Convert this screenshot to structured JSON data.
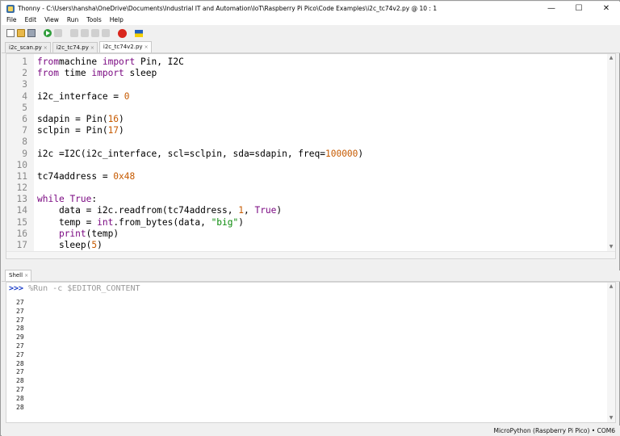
{
  "window": {
    "title": "Thonny  -  C:\\Users\\hansha\\OneDrive\\Documents\\Industrial IT and Automation\\IoT\\Raspberry Pi Pico\\Code Examples\\i2c_tc74v2.py  @  10 : 1",
    "minimize": "—",
    "maximize": "☐",
    "close": "✕"
  },
  "menu": [
    "File",
    "Edit",
    "View",
    "Run",
    "Tools",
    "Help"
  ],
  "tabs": [
    {
      "label": "i2c_scan.py",
      "active": false
    },
    {
      "label": "i2c_tc74.py",
      "active": false
    },
    {
      "label": "i2c_tc74v2.py",
      "active": true
    }
  ],
  "tab_close": "×",
  "editor": {
    "lines": [
      {
        "n": "1",
        "t": [
          [
            "kw",
            "from"
          ],
          [
            "",
            "machine "
          ],
          [
            "kw",
            "import"
          ],
          [
            "",
            " Pin, I2C"
          ]
        ]
      },
      {
        "n": "2",
        "t": [
          [
            "kw",
            "from"
          ],
          [
            "",
            " time "
          ],
          [
            "kw",
            "import"
          ],
          [
            "",
            " sleep"
          ]
        ]
      },
      {
        "n": "3",
        "t": []
      },
      {
        "n": "4",
        "t": [
          [
            "",
            "i2c_interface = "
          ],
          [
            "num",
            "0"
          ]
        ]
      },
      {
        "n": "5",
        "t": []
      },
      {
        "n": "6",
        "t": [
          [
            "",
            "sdapin = Pin("
          ],
          [
            "num",
            "16"
          ],
          [
            "",
            ")"
          ]
        ]
      },
      {
        "n": "7",
        "t": [
          [
            "",
            "sclpin = Pin("
          ],
          [
            "num",
            "17"
          ],
          [
            "",
            ")"
          ]
        ]
      },
      {
        "n": "8",
        "t": []
      },
      {
        "n": "9",
        "t": [
          [
            "",
            "i2c =I2C(i2c_interface, scl=sclpin, sda=sdapin, freq="
          ],
          [
            "num",
            "100000"
          ],
          [
            "",
            ")"
          ]
        ]
      },
      {
        "n": "10",
        "t": []
      },
      {
        "n": "11",
        "t": [
          [
            "",
            "tc74address = "
          ],
          [
            "num",
            "0x48"
          ]
        ]
      },
      {
        "n": "12",
        "t": []
      },
      {
        "n": "13",
        "t": [
          [
            "kw",
            "while"
          ],
          [
            "",
            " "
          ],
          [
            "kw",
            "True"
          ],
          [
            "",
            ":"
          ]
        ]
      },
      {
        "n": "14",
        "t": [
          [
            "",
            "    data = i2c.readfrom(tc74address, "
          ],
          [
            "num",
            "1"
          ],
          [
            "",
            ", "
          ],
          [
            "kw",
            "True"
          ],
          [
            "",
            ")"
          ]
        ]
      },
      {
        "n": "15",
        "t": [
          [
            "",
            "    temp = "
          ],
          [
            "bi",
            "int"
          ],
          [
            "",
            ".from_bytes(data, "
          ],
          [
            "str",
            "\"big\""
          ],
          [
            "",
            ")"
          ]
        ]
      },
      {
        "n": "16",
        "t": [
          [
            "",
            "    "
          ],
          [
            "bi",
            "print"
          ],
          [
            "",
            "(temp)"
          ]
        ]
      },
      {
        "n": "17",
        "t": [
          [
            "",
            "    sleep("
          ],
          [
            "num",
            "5"
          ],
          [
            "",
            ")"
          ]
        ]
      }
    ]
  },
  "shell": {
    "tab_label": "Shell",
    "prompt": ">>>",
    "command": " %Run -c $EDITOR_CONTENT",
    "output": [
      "27",
      "27",
      "27",
      "28",
      "29",
      "27",
      "27",
      "28",
      "27",
      "28",
      "27",
      "28",
      "28"
    ]
  },
  "status": {
    "text": "MicroPython (Raspberry Pi Pico)  •  COM6"
  }
}
